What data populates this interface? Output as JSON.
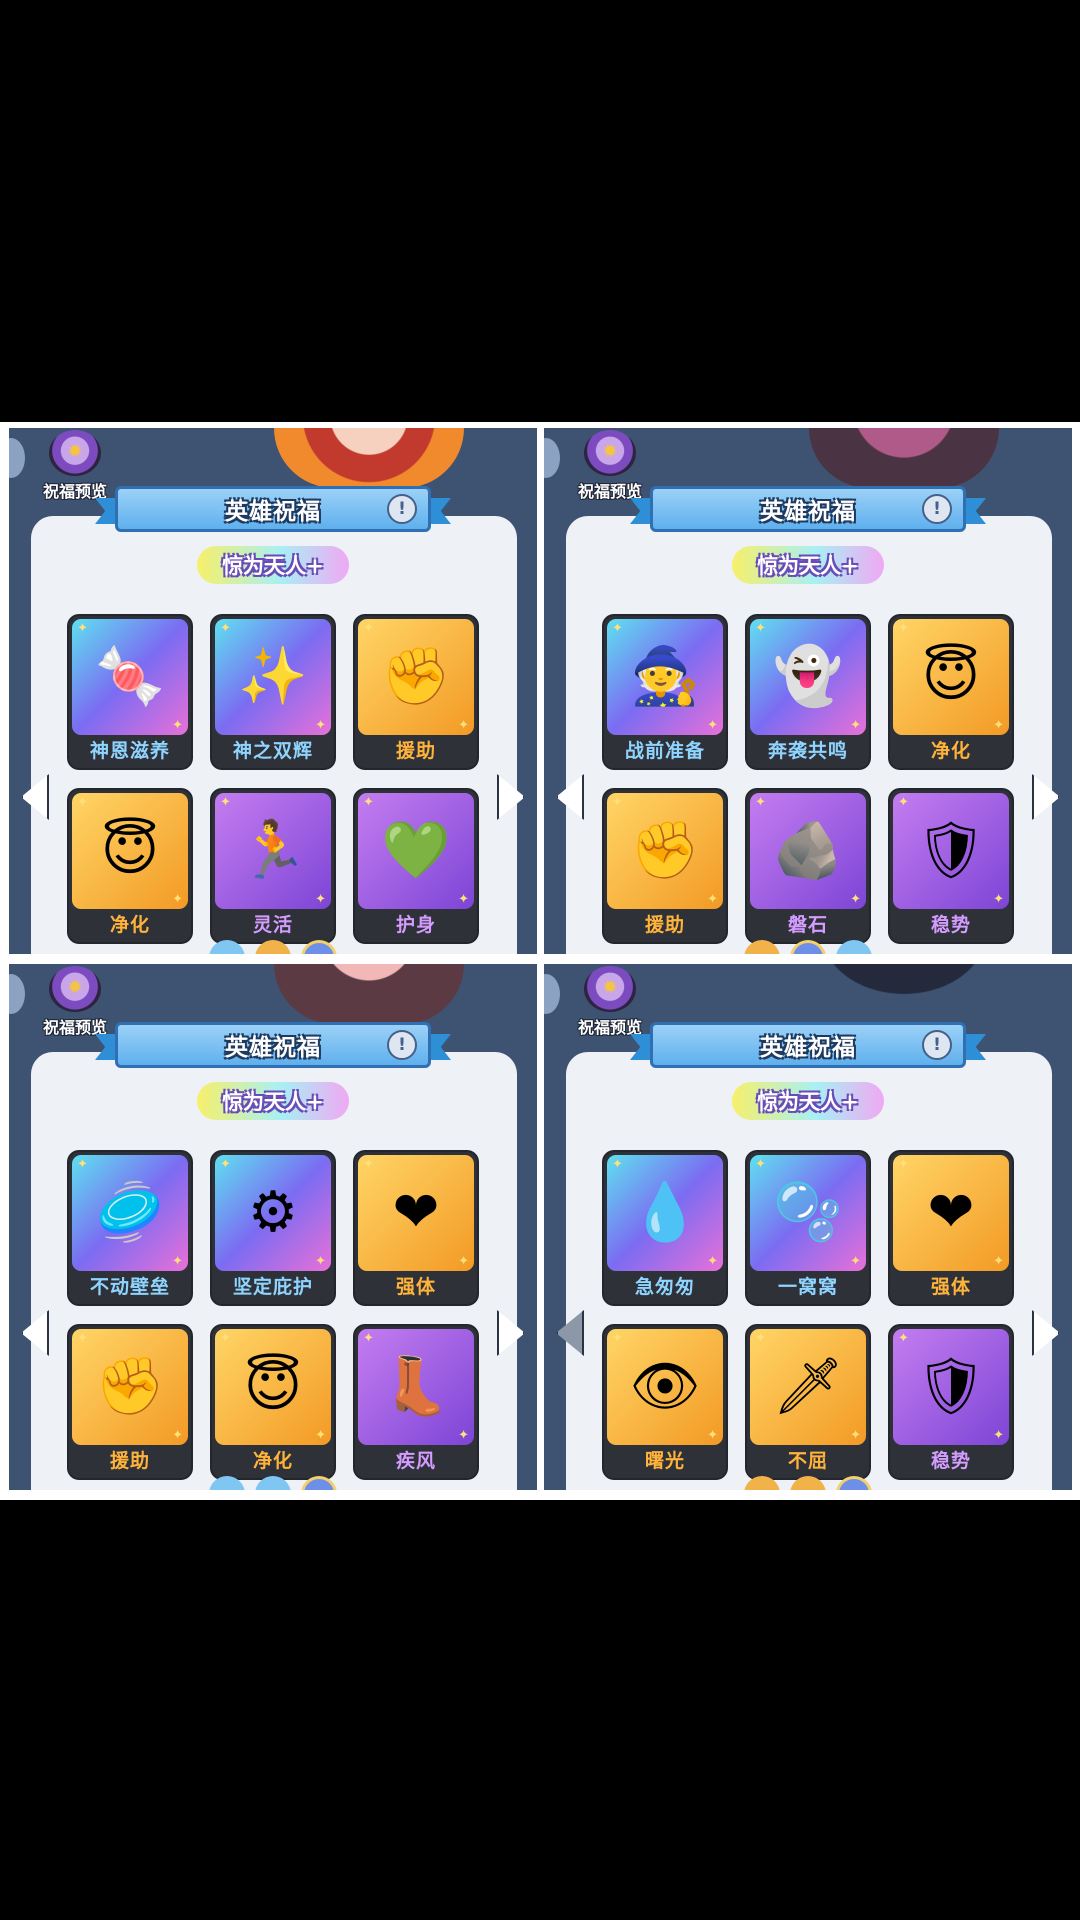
{
  "panels": [
    {
      "preview_label": "祝福预览",
      "title": "英雄祝福",
      "info_icon": "!",
      "tier": "惊为天人+",
      "blessings": [
        {
          "name": "神恩滋养",
          "icon": "candy-flower-icon",
          "glyph": "🍬",
          "rarity": "holo"
        },
        {
          "name": "神之双辉",
          "icon": "sparkle-orb-icon",
          "glyph": "✨",
          "rarity": "holo"
        },
        {
          "name": "援助",
          "icon": "helper-hand-icon",
          "glyph": "✊",
          "rarity": "gold"
        },
        {
          "name": "净化",
          "icon": "angel-wings-icon",
          "glyph": "😇",
          "rarity": "gold"
        },
        {
          "name": "灵活",
          "icon": "dash-figure-icon",
          "glyph": "🏃",
          "rarity": "purple"
        },
        {
          "name": "护身",
          "icon": "heart-shield-icon",
          "glyph": "💚",
          "rarity": "purple"
        }
      ]
    },
    {
      "preview_label": "祝福预览",
      "title": "英雄祝福",
      "info_icon": "!",
      "tier": "惊为天人+",
      "blessings": [
        {
          "name": "战前准备",
          "icon": "dark-mage-icon",
          "glyph": "🧙",
          "rarity": "holo"
        },
        {
          "name": "奔袭共鸣",
          "icon": "twin-spirits-icon",
          "glyph": "👻",
          "rarity": "holo"
        },
        {
          "name": "净化",
          "icon": "angel-wings-icon",
          "glyph": "😇",
          "rarity": "gold"
        },
        {
          "name": "援助",
          "icon": "helper-hand-icon",
          "glyph": "✊",
          "rarity": "gold"
        },
        {
          "name": "磐石",
          "icon": "rock-up-icon",
          "glyph": "🪨",
          "rarity": "purple"
        },
        {
          "name": "稳势",
          "icon": "wood-shield-icon",
          "glyph": "🛡",
          "rarity": "purple"
        }
      ]
    },
    {
      "preview_label": "祝福预览",
      "title": "英雄祝福",
      "info_icon": "!",
      "tier": "惊为天人+",
      "blessings": [
        {
          "name": "不动壁垒",
          "icon": "stone-disc-icon",
          "glyph": "🥏",
          "rarity": "holo"
        },
        {
          "name": "坚定庇护",
          "icon": "gear-ring-icon",
          "glyph": "⚙",
          "rarity": "holo"
        },
        {
          "name": "强体",
          "icon": "red-heart-icon",
          "glyph": "❤",
          "rarity": "gold"
        },
        {
          "name": "援助",
          "icon": "helper-hand-icon",
          "glyph": "✊",
          "rarity": "gold"
        },
        {
          "name": "净化",
          "icon": "angel-wings-icon",
          "glyph": "😇",
          "rarity": "gold"
        },
        {
          "name": "疾风",
          "icon": "speed-boot-icon",
          "glyph": "👢",
          "rarity": "purple"
        }
      ]
    },
    {
      "preview_label": "祝福预览",
      "title": "英雄祝福",
      "info_icon": "!",
      "tier": "惊为天人+",
      "blessings": [
        {
          "name": "急匆匆",
          "icon": "blue-comet-icon",
          "glyph": "💧",
          "rarity": "holo"
        },
        {
          "name": "一窝窝",
          "icon": "slime-trio-icon",
          "glyph": "🫧",
          "rarity": "holo"
        },
        {
          "name": "强体",
          "icon": "red-heart-icon",
          "glyph": "❤",
          "rarity": "gold"
        },
        {
          "name": "曙光",
          "icon": "golden-eye-icon",
          "glyph": "👁",
          "rarity": "gold"
        },
        {
          "name": "不屈",
          "icon": "sword-icon",
          "glyph": "🗡",
          "rarity": "gold"
        },
        {
          "name": "稳势",
          "icon": "wood-shield-icon",
          "glyph": "🛡",
          "rarity": "purple"
        }
      ]
    }
  ]
}
